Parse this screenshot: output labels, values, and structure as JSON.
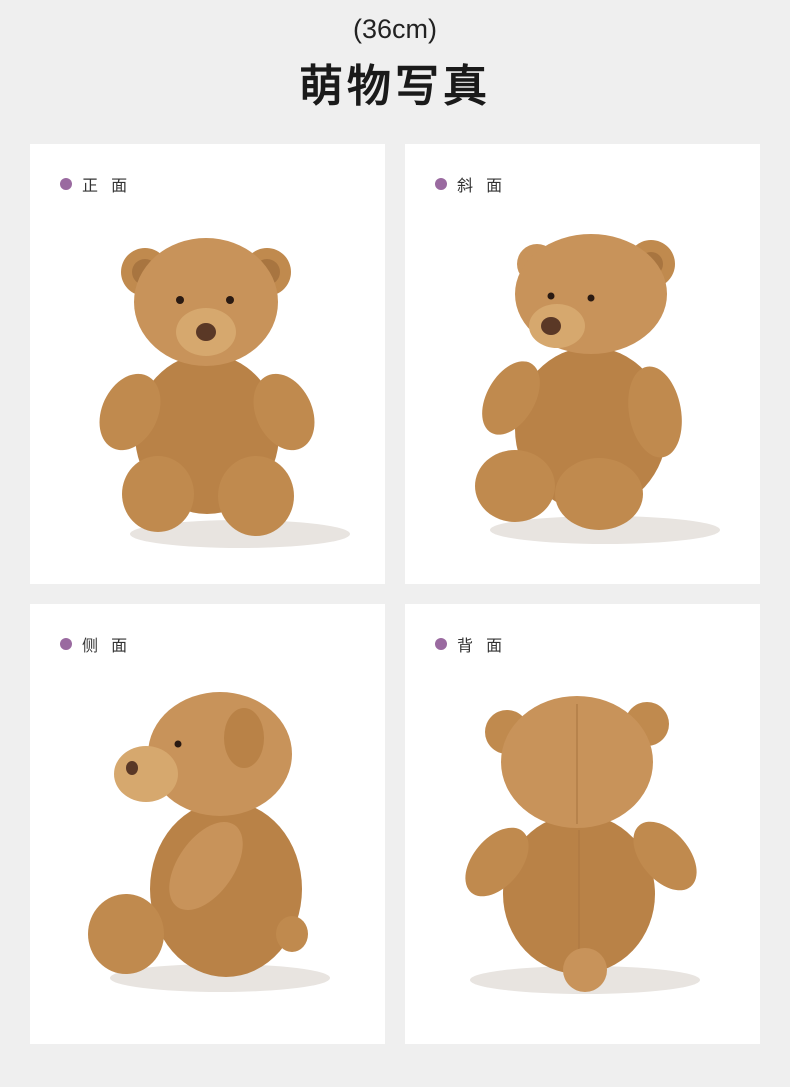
{
  "header": {
    "size": "(36cm)",
    "title": "萌物写真"
  },
  "colors": {
    "background": "#efefef",
    "card": "#ffffff",
    "dot": "#9a6aa0",
    "bear_fur": "#c08a4e",
    "bear_nose": "#5a3826"
  },
  "cards": [
    {
      "label": "正 面"
    },
    {
      "label": "斜 面"
    },
    {
      "label": "侧 面"
    },
    {
      "label": "背 面"
    }
  ]
}
